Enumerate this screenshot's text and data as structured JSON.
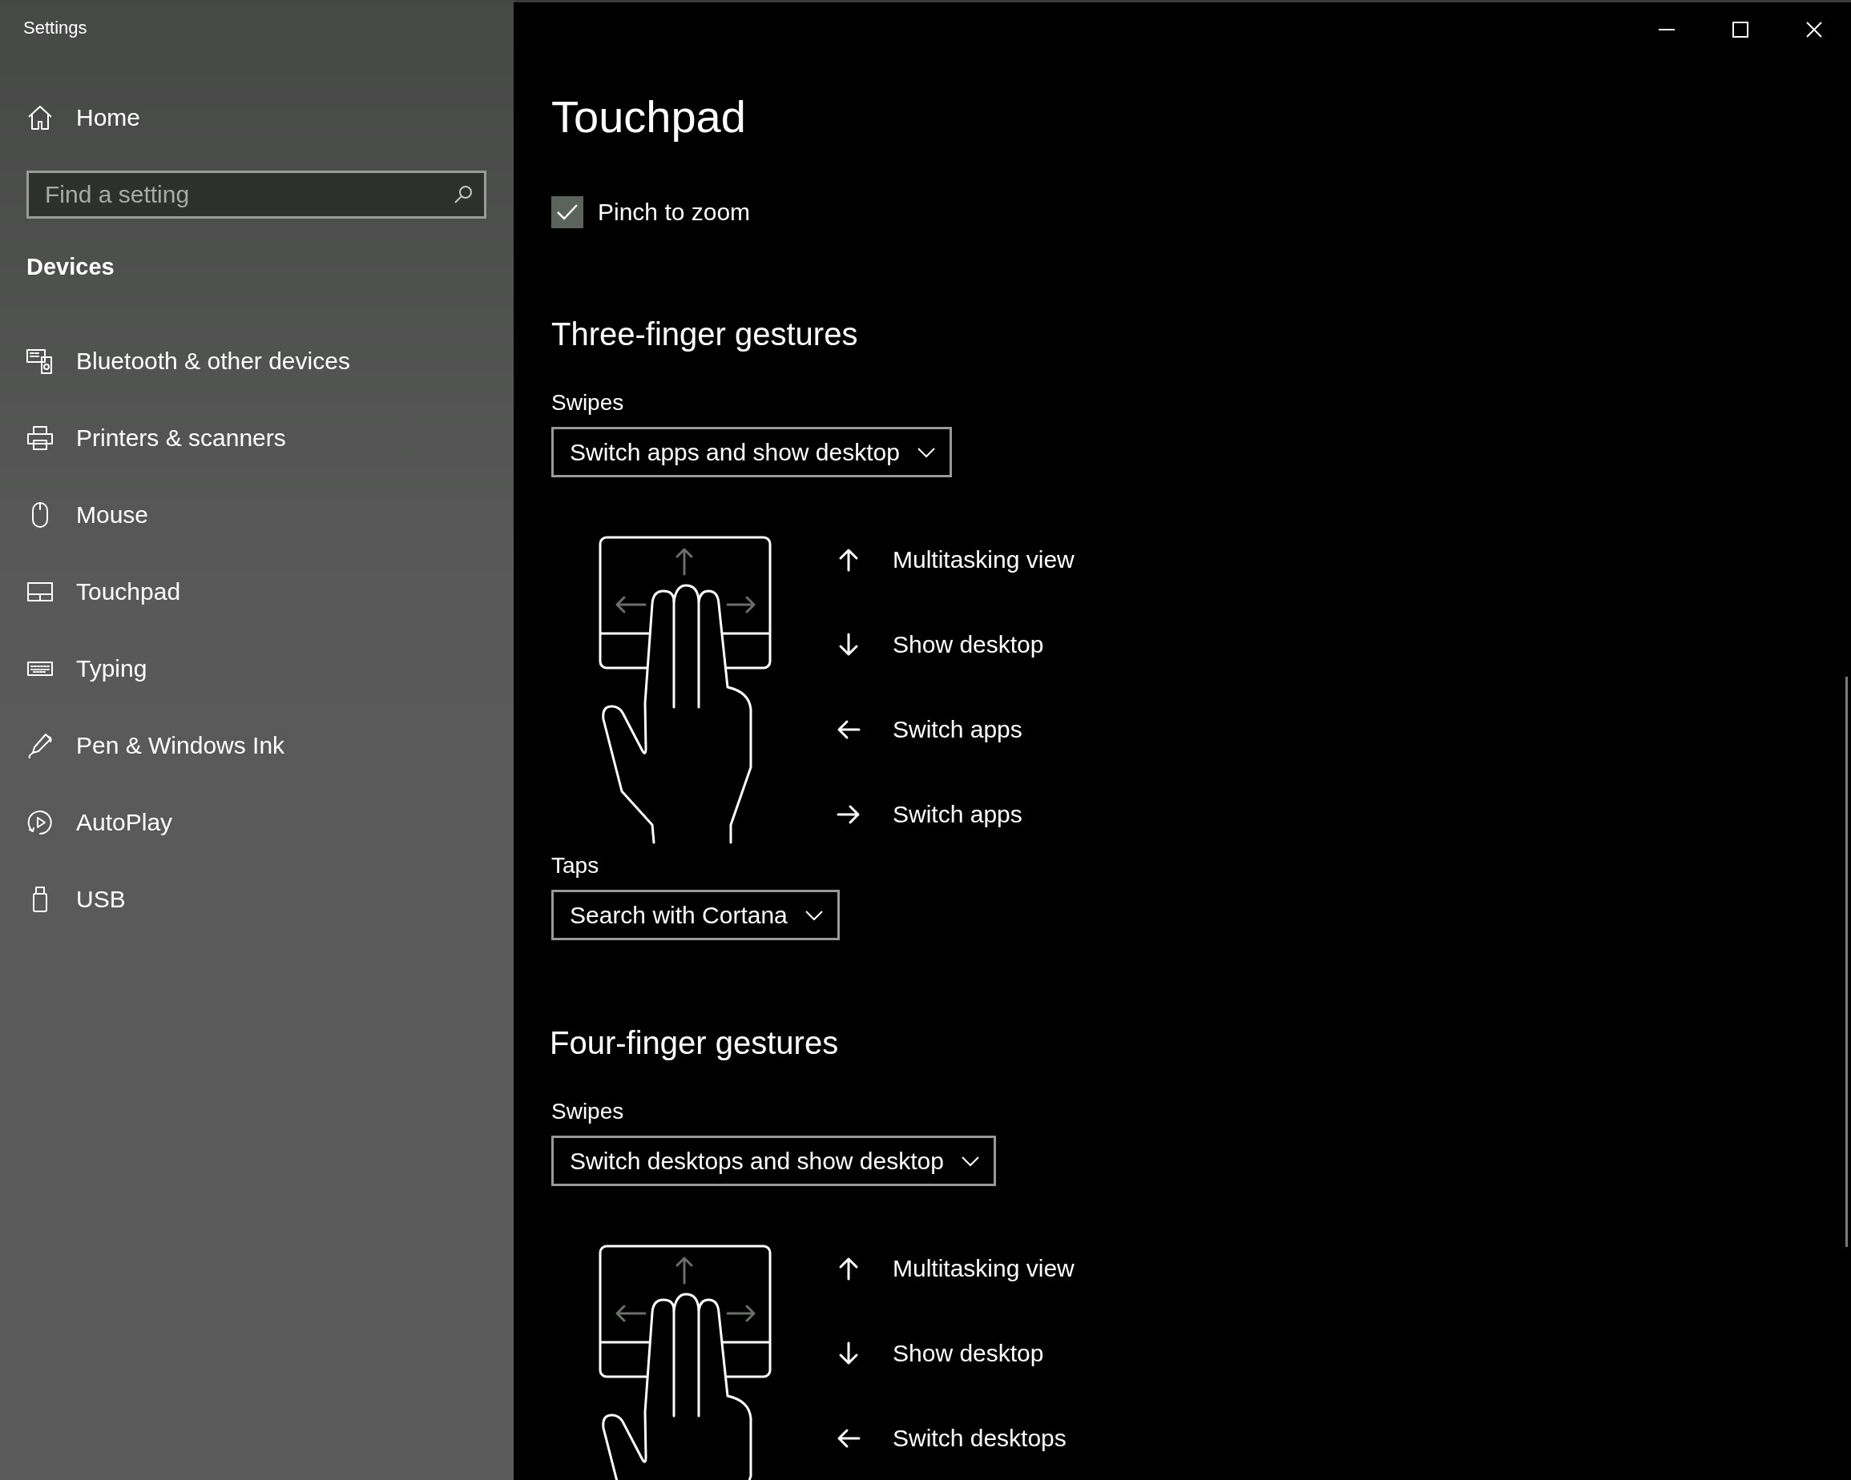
{
  "window": {
    "title": "Settings"
  },
  "sidebar": {
    "home": "Home",
    "search": {
      "placeholder": "Find a setting"
    },
    "section": "Devices",
    "items": [
      {
        "label": "Bluetooth & other devices"
      },
      {
        "label": "Printers & scanners"
      },
      {
        "label": "Mouse"
      },
      {
        "label": "Touchpad"
      },
      {
        "label": "Typing"
      },
      {
        "label": "Pen & Windows Ink"
      },
      {
        "label": "AutoPlay"
      },
      {
        "label": "USB"
      }
    ]
  },
  "page": {
    "title": "Touchpad",
    "checkbox": {
      "label": "Pinch to zoom",
      "checked": true
    },
    "sections": [
      {
        "heading": "Three-finger gestures",
        "swipes": {
          "label": "Swipes",
          "value": "Switch apps and show desktop",
          "gestures": [
            {
              "kind": "up",
              "label": "Multitasking view"
            },
            {
              "kind": "down",
              "label": "Show desktop"
            },
            {
              "kind": "left",
              "label": "Switch apps"
            },
            {
              "kind": "right",
              "label": "Switch apps"
            }
          ]
        },
        "taps": {
          "label": "Taps",
          "value": "Search with Cortana"
        }
      },
      {
        "heading": "Four-finger gestures",
        "swipes": {
          "label": "Swipes",
          "value": "Switch desktops and show desktop",
          "gestures": [
            {
              "kind": "up",
              "label": "Multitasking view"
            },
            {
              "kind": "down",
              "label": "Show desktop"
            },
            {
              "kind": "left",
              "label": "Switch desktops"
            }
          ]
        }
      }
    ]
  }
}
